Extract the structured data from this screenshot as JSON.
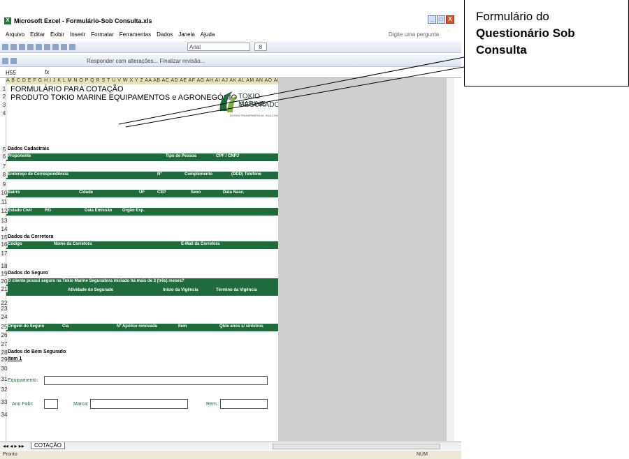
{
  "window": {
    "title": "Microsoft Excel - Formulário-Sob Consulta.xls",
    "min": "_",
    "max": "□",
    "close": "X"
  },
  "menu": [
    "Arquivo",
    "Editar",
    "Exibir",
    "Inserir",
    "Formatar",
    "Ferramentas",
    "Dados",
    "Janela",
    "Ajuda"
  ],
  "ask": "Digite uma pergunta",
  "toolbar": {
    "font": "Arial",
    "size": "8",
    "review": "Responder com alterações... Finalizar revisão..."
  },
  "namebox": {
    "cell": "H55",
    "fx": "fx"
  },
  "column_header": "A B C D E F G H I J K L M N O P Q R S T U V W X Y Z AA AB AC AD AE AF AG AH AI AJ AK AL AM AN AO AP AQ AR AS AT AU AV AW",
  "form": {
    "title1": "FORMULÁRIO PARA COTAÇÃO",
    "title2": "PRODUTO TOKIO MARINE EQUIPAMENTOS e AGRONEGÓCIO",
    "logo1": "TOKIO MARINE",
    "logo2": "SEGURADORA",
    "logo3": "NOSSA TRANSPARÊNCIA, SUA CONFIANÇA",
    "s_cadastrais": "Dados Cadastrais",
    "h6": [
      "Proponente",
      "Tipo de Pessoa",
      "CPF / CNPJ"
    ],
    "h8": [
      "Endereço de Correspondência",
      "Nº",
      "Complemento",
      "(DDD) Telefone"
    ],
    "h10": [
      "Bairro",
      "Cidade",
      "UF",
      "CEP",
      "Sexo",
      "Data Nasc."
    ],
    "h12": [
      "Estado Civil",
      "RG",
      "Data Emissão",
      "Orgão Exp."
    ],
    "s_corretora": "Dados da Corretora",
    "h16": [
      "Código",
      "Nome da Corretora",
      "E-Mail da Corretora"
    ],
    "s_seguro": "Dados do Seguro",
    "h20": "O cliente possui seguro na Tokio Marine Seguradora iniciado há mais de 3 (três) meses?",
    "h21": [
      "Atividade do Segurado",
      "Início da Vigência",
      "Término da Vigência"
    ],
    "h25": [
      "Origem do Seguro",
      "Cia",
      "Nº Apólice renovada",
      "Item",
      "Qtde anos s/ sinistros"
    ],
    "s_bem": "Dados do Bem Segurado",
    "item": "Item 1",
    "equip": "Equipamento:",
    "ano": "Ano Fabr:",
    "marca": "Marca:",
    "rem": "Rem.:"
  },
  "rows": [
    "1",
    "2",
    "3",
    "4",
    "5",
    "6",
    "7",
    "8",
    "9",
    "10",
    "11",
    "12",
    "13",
    "14",
    "15",
    "16",
    "17",
    "18",
    "19",
    "20",
    "21",
    "22",
    "23",
    "24",
    "25",
    "26",
    "27",
    "28",
    "29",
    "30",
    "31",
    "32",
    "33",
    "34"
  ],
  "sheet_tab": "COTAÇÃO",
  "status": {
    "left": "Pronto",
    "right": "NÚM"
  },
  "callout": {
    "line1": "Formulário do",
    "line2": "Questionário Sob",
    "line3": "Consulta"
  }
}
